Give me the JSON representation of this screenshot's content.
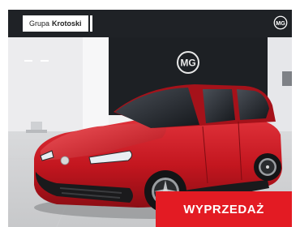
{
  "header": {
    "dealer_prefix": "Grupa",
    "dealer_name": "Krotoski",
    "brand_logo_text": "MG"
  },
  "showroom": {
    "wall_logo_text": "MG"
  },
  "cta": {
    "label": "WYPRZEDAŻ"
  },
  "colors": {
    "topbar": "#1f2226",
    "accent_red": "#e31b23",
    "car_red": "#c3161f"
  }
}
